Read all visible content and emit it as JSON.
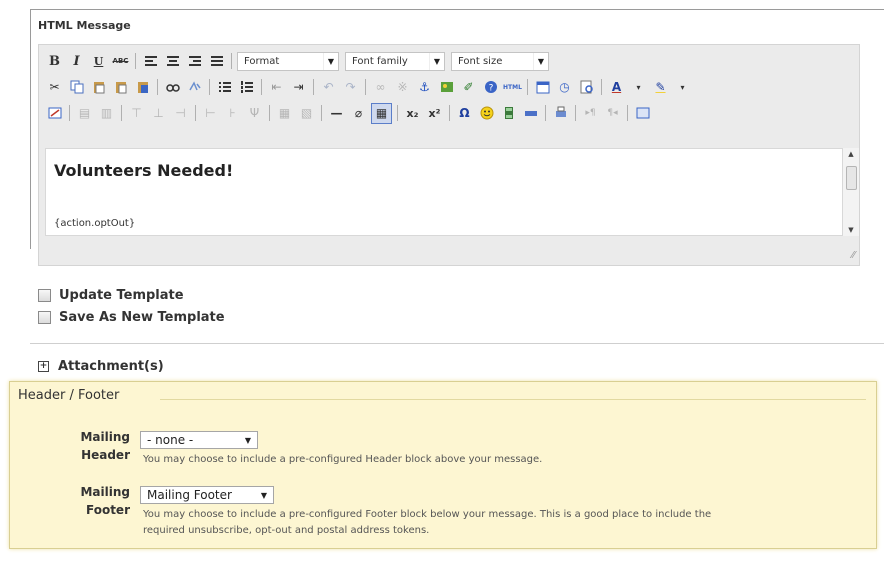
{
  "section_title": "HTML Message",
  "toolbar": {
    "bold": "B",
    "italic": "I",
    "underline": "U",
    "strike": "ABC",
    "format_select": "Format",
    "font_family_select": "Font family",
    "font_size_select": "Font size",
    "html_btn": "HTML",
    "superscript": "x²",
    "subscript": "x₂",
    "omega": "Ω",
    "font_color": "A"
  },
  "editor": {
    "heading": "Volunteers Needed!",
    "token": "{action.optOut}"
  },
  "options": {
    "update_template": "Update Template",
    "save_as_new": "Save As New Template"
  },
  "attachments": {
    "label": "Attachment(s)",
    "expand_glyph": "+"
  },
  "header_footer": {
    "legend": "Header / Footer",
    "mailing_header": {
      "label_1": "Mailing",
      "label_2": "Header",
      "selected": "- none -",
      "help": "You may choose to include a pre-configured Header block above your message."
    },
    "mailing_footer": {
      "label_1": "Mailing",
      "label_2": "Footer",
      "selected": "Mailing Footer",
      "help_1": "You may choose to include a pre-configured Footer block below your message. This is a good place to include the",
      "help_2": "required unsubscribe, opt-out and postal address tokens."
    }
  },
  "colors": {
    "accent_blue": "#1f4fbf",
    "panel_yellow": "#fdf6d2",
    "toolbar_grey": "#ebebeb"
  }
}
